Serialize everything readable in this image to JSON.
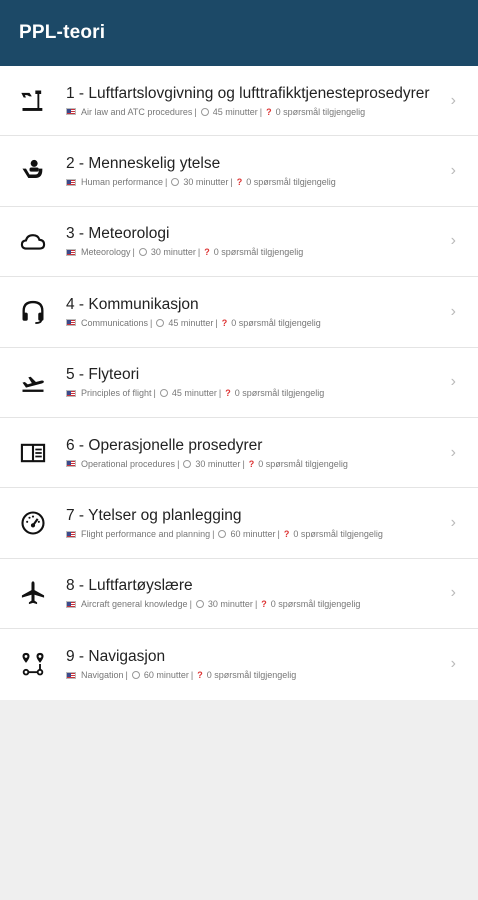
{
  "app": {
    "title": "PPL-teori"
  },
  "sep": "|",
  "items": [
    {
      "title": "1 - Luftfartslovgivning og lufttrafikktjenesteprosedyrer",
      "english": "Air law and ATC procedures",
      "duration": "45 minutter",
      "questions": "0 spørsmål tilgjengelig",
      "icon": "airport-icon"
    },
    {
      "title": "2 - Menneskelig ytelse",
      "english": "Human performance",
      "duration": "30 minutter",
      "questions": "0 spørsmål tilgjengelig",
      "icon": "seated-person-icon"
    },
    {
      "title": "3 - Meteorologi",
      "english": "Meteorology",
      "duration": "30 minutter",
      "questions": "0 spørsmål tilgjengelig",
      "icon": "cloud-icon"
    },
    {
      "title": "4 - Kommunikasjon",
      "english": "Communications",
      "duration": "45 minutter",
      "questions": "0 spørsmål tilgjengelig",
      "icon": "headset-icon"
    },
    {
      "title": "5 - Flyteori",
      "english": "Principles of flight",
      "duration": "45 minutter",
      "questions": "0 spørsmål tilgjengelig",
      "icon": "flight-takeoff-icon"
    },
    {
      "title": "6 - Operasjonelle prosedyrer",
      "english": "Operational procedures",
      "duration": "30 minutter",
      "questions": "0 spørsmål tilgjengelig",
      "icon": "manual-icon"
    },
    {
      "title": "7 - Ytelser og planlegging",
      "english": "Flight performance and planning",
      "duration": "60 minutter",
      "questions": "0 spørsmål tilgjengelig",
      "icon": "speedometer-icon"
    },
    {
      "title": "8 - Luftfartøyslære",
      "english": "Aircraft general knowledge",
      "duration": "30 minutter",
      "questions": "0 spørsmål tilgjengelig",
      "icon": "airplane-icon"
    },
    {
      "title": "9 - Navigasjon",
      "english": "Navigation",
      "duration": "60 minutter",
      "questions": "0 spørsmål tilgjengelig",
      "icon": "route-icon"
    }
  ],
  "colors": {
    "appbar": "#1c4967",
    "background": "#efefef",
    "question_mark": "#dd3333"
  }
}
